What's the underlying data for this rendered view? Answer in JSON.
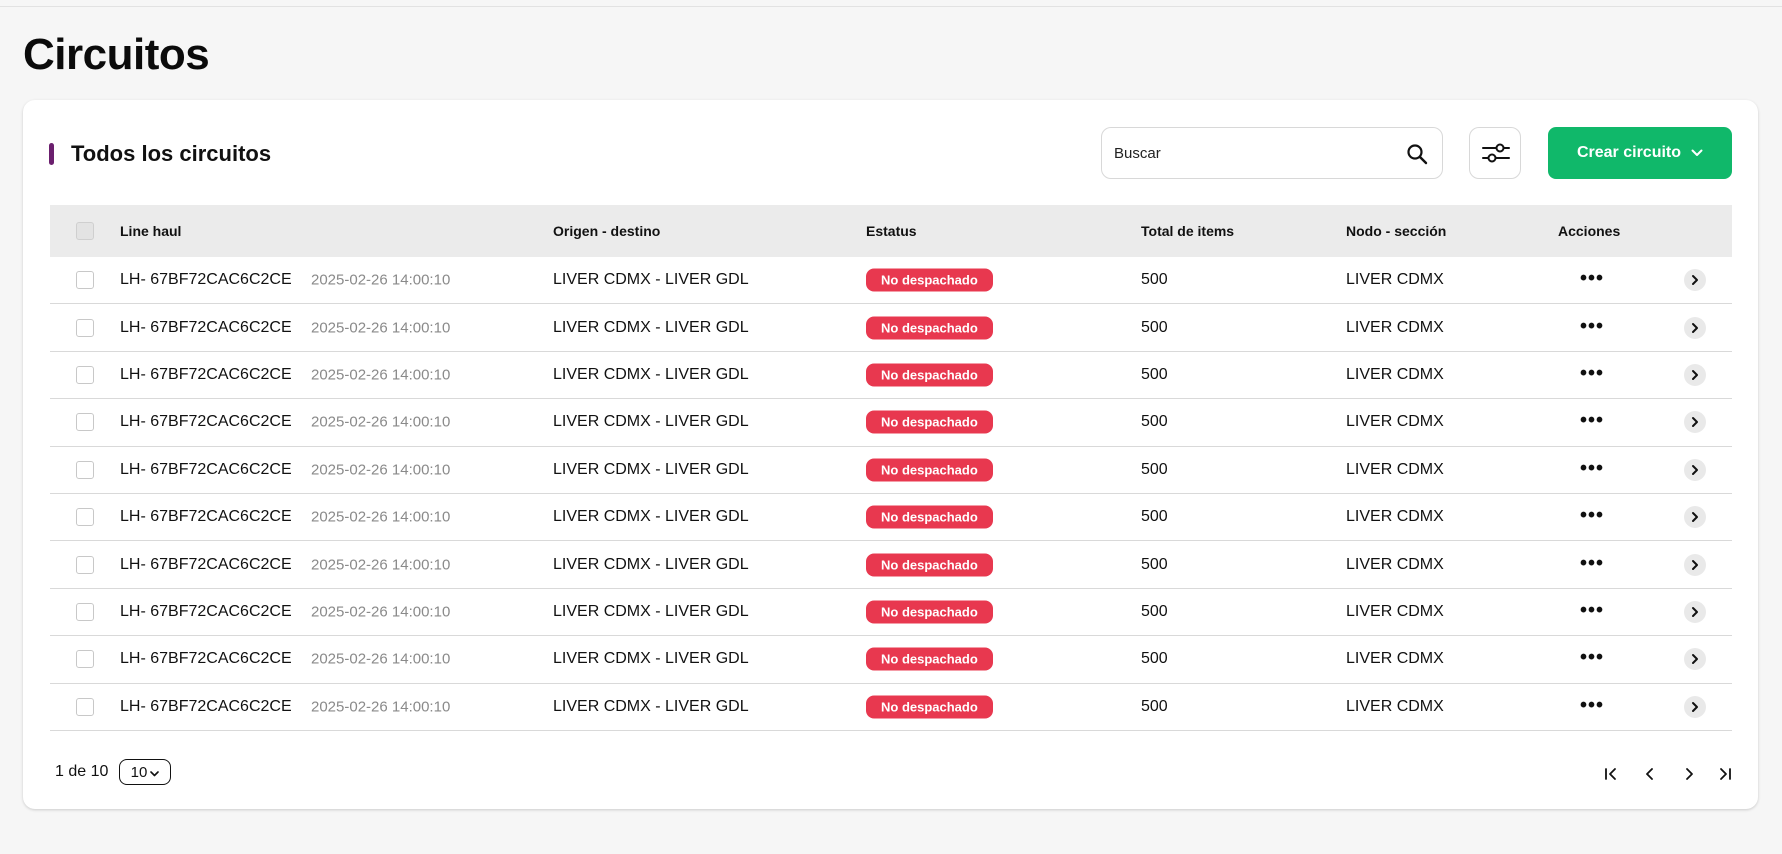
{
  "page": {
    "title": "Circuitos"
  },
  "card": {
    "title": "Todos los circuitos"
  },
  "search": {
    "placeholder": "Buscar"
  },
  "toolbar": {
    "create_label": "Crear circuito",
    "filter_icon": "sliders-icon"
  },
  "colors": {
    "accent": "#6b1f6e",
    "primary": "#10b86a",
    "status_red": "#e8384f"
  },
  "table": {
    "headers": {
      "line_haul": "Line haul",
      "route": "Origen - destino",
      "status": "Estatus",
      "total": "Total de items",
      "node": "Nodo - sección",
      "actions": "Acciones"
    },
    "rows": [
      {
        "id": "LH- 67BF72CAC6C2CE",
        "date": "2025-02-26 14:00:10",
        "route": "LIVER CDMX - LIVER GDL",
        "status": "No despachado",
        "total": "500",
        "node": "LIVER CDMX"
      },
      {
        "id": "LH- 67BF72CAC6C2CE",
        "date": "2025-02-26 14:00:10",
        "route": "LIVER CDMX - LIVER GDL",
        "status": "No despachado",
        "total": "500",
        "node": "LIVER CDMX"
      },
      {
        "id": "LH- 67BF72CAC6C2CE",
        "date": "2025-02-26 14:00:10",
        "route": "LIVER CDMX - LIVER GDL",
        "status": "No despachado",
        "total": "500",
        "node": "LIVER CDMX"
      },
      {
        "id": "LH- 67BF72CAC6C2CE",
        "date": "2025-02-26 14:00:10",
        "route": "LIVER CDMX - LIVER GDL",
        "status": "No despachado",
        "total": "500",
        "node": "LIVER CDMX"
      },
      {
        "id": "LH- 67BF72CAC6C2CE",
        "date": "2025-02-26 14:00:10",
        "route": "LIVER CDMX - LIVER GDL",
        "status": "No despachado",
        "total": "500",
        "node": "LIVER CDMX"
      },
      {
        "id": "LH- 67BF72CAC6C2CE",
        "date": "2025-02-26 14:00:10",
        "route": "LIVER CDMX - LIVER GDL",
        "status": "No despachado",
        "total": "500",
        "node": "LIVER CDMX"
      },
      {
        "id": "LH- 67BF72CAC6C2CE",
        "date": "2025-02-26 14:00:10",
        "route": "LIVER CDMX - LIVER GDL",
        "status": "No despachado",
        "total": "500",
        "node": "LIVER CDMX"
      },
      {
        "id": "LH- 67BF72CAC6C2CE",
        "date": "2025-02-26 14:00:10",
        "route": "LIVER CDMX - LIVER GDL",
        "status": "No despachado",
        "total": "500",
        "node": "LIVER CDMX"
      },
      {
        "id": "LH- 67BF72CAC6C2CE",
        "date": "2025-02-26 14:00:10",
        "route": "LIVER CDMX - LIVER GDL",
        "status": "No despachado",
        "total": "500",
        "node": "LIVER CDMX"
      },
      {
        "id": "LH- 67BF72CAC6C2CE",
        "date": "2025-02-26 14:00:10",
        "route": "LIVER CDMX - LIVER GDL",
        "status": "No despachado",
        "total": "500",
        "node": "LIVER CDMX"
      }
    ]
  },
  "pagination": {
    "label": "1 de 10",
    "page_size": "10"
  }
}
